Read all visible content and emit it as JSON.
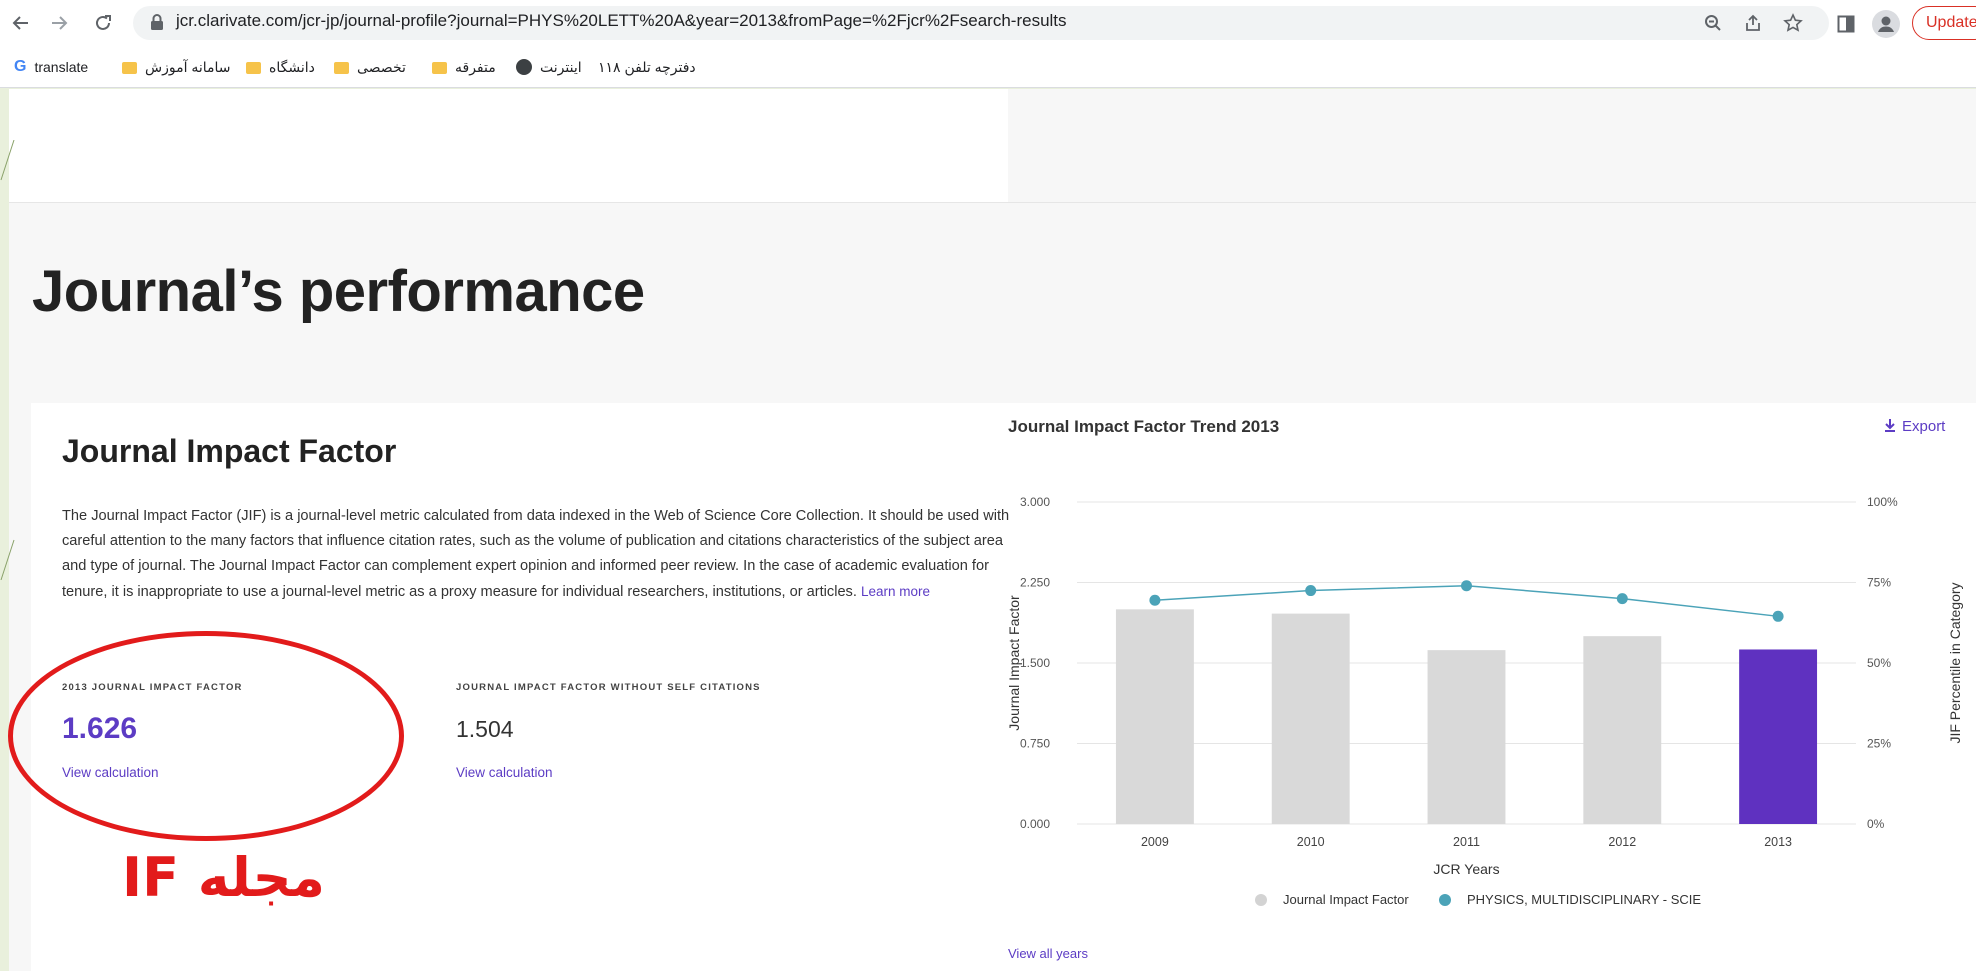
{
  "browser": {
    "url": "jcr.clarivate.com/jcr-jp/journal-profile?journal=PHYS%20LETT%20A&year=2013&fromPage=%2Fjcr%2Fsearch-results",
    "update_label": "Update",
    "bookmarks": [
      {
        "label": "translate",
        "icon": "google-icon"
      },
      {
        "label": "سامانه آموزش",
        "icon": "folder-icon"
      },
      {
        "label": "دانشگاه",
        "icon": "folder-icon"
      },
      {
        "label": "تخصصی",
        "icon": "folder-icon"
      },
      {
        "label": "متفرقه",
        "icon": "folder-icon"
      },
      {
        "label": "اینترنت",
        "icon": "globe-icon"
      },
      {
        "label": "دفترچه تلفن ۱۱۸",
        "icon": "none"
      }
    ]
  },
  "page": {
    "title": "Journal’s performance",
    "jif": {
      "title": "Journal Impact Factor",
      "description": "The Journal Impact Factor (JIF) is a journal-level metric calculated from data indexed in the Web of Science Core Collection. It should be used with careful attention to the many factors that influence citation rates, such as the volume of publication and citations characteristics of the subject area and type of journal. The Journal Impact Factor can complement expert opinion and informed peer review. In the case of academic evaluation for tenure, it is inappropriate to use a journal-level metric as a proxy measure for individual researchers, institutions, or articles.",
      "learn_more": "Learn more",
      "metrics": [
        {
          "label": "2013 JOURNAL IMPACT FACTOR",
          "value": "1.626",
          "link": "View calculation"
        },
        {
          "label": "JOURNAL IMPACT FACTOR WITHOUT SELF CITATIONS",
          "value": "1.504",
          "link": "View calculation"
        }
      ]
    },
    "annotation": "IF مجله",
    "export_label": "Export",
    "view_all_years": "View all years"
  },
  "colors": {
    "accent": "#5c3cc4",
    "bar": "#d9d9d9",
    "line": "#4ba3b8",
    "annotation": "#e21b1b"
  },
  "chart_data": {
    "type": "bar",
    "title": "Journal Impact Factor Trend 2013",
    "categories": [
      "2009",
      "2010",
      "2011",
      "2012",
      "2013"
    ],
    "series": [
      {
        "name": "Journal Impact Factor",
        "kind": "bar",
        "axis": "left",
        "values": [
          2.0,
          1.96,
          1.62,
          1.75,
          1.626
        ]
      },
      {
        "name": "PHYSICS, MULTIDISCIPLINARY - SCIE",
        "kind": "line",
        "axis": "right",
        "values": [
          69.5,
          72.5,
          74,
          70,
          64.5
        ]
      }
    ],
    "xlabel": "JCR Years",
    "ylabel": "Journal Impact Factor",
    "y2label": "JIF Percentile in Category",
    "ylim": [
      0,
      3
    ],
    "y2lim": [
      0,
      100
    ],
    "yticks": [
      "0.000",
      "0.750",
      "1.500",
      "2.250",
      "3.000"
    ],
    "y2ticks": [
      "0%",
      "25%",
      "50%",
      "75%",
      "100%"
    ],
    "highlight_category": "2013",
    "highlight_color": "#5f31c0",
    "grid": true,
    "legend_position": "bottom"
  }
}
